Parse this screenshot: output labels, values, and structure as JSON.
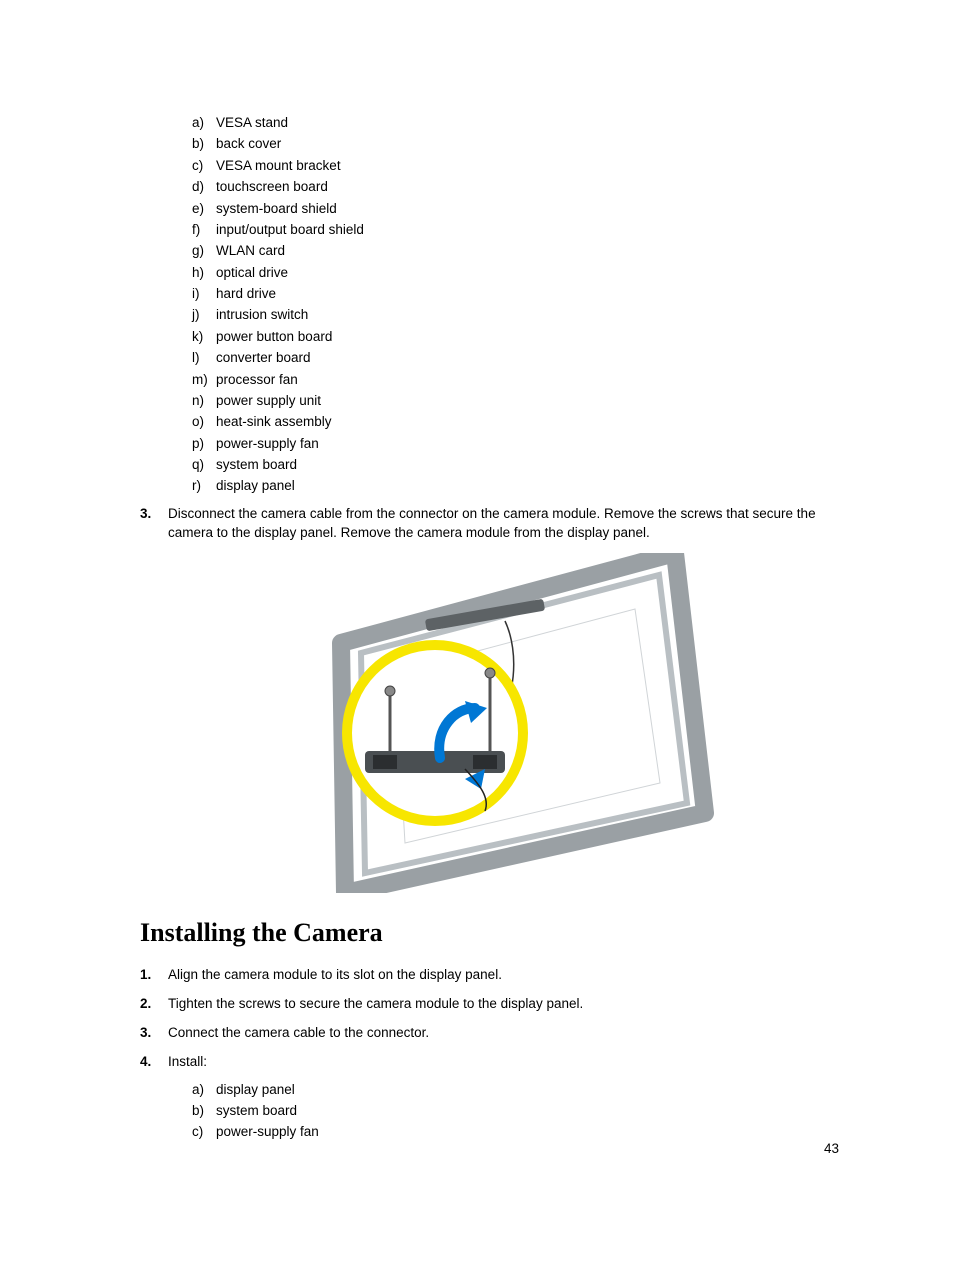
{
  "removeAlphaList": [
    {
      "marker": "a)",
      "text": "VESA stand"
    },
    {
      "marker": "b)",
      "text": "back cover"
    },
    {
      "marker": "c)",
      "text": "VESA mount bracket"
    },
    {
      "marker": "d)",
      "text": "touchscreen board"
    },
    {
      "marker": "e)",
      "text": "system-board shield"
    },
    {
      "marker": "f)",
      "text": "input/output board shield"
    },
    {
      "marker": "g)",
      "text": "WLAN card"
    },
    {
      "marker": "h)",
      "text": "optical drive"
    },
    {
      "marker": "i)",
      "text": "hard drive"
    },
    {
      "marker": "j)",
      "text": "intrusion switch"
    },
    {
      "marker": "k)",
      "text": "power button board"
    },
    {
      "marker": "l)",
      "text": "converter board"
    },
    {
      "marker": "m)",
      "text": "processor fan"
    },
    {
      "marker": "n)",
      "text": "power supply unit"
    },
    {
      "marker": "o)",
      "text": "heat-sink assembly"
    },
    {
      "marker": "p)",
      "text": "power-supply fan"
    },
    {
      "marker": "q)",
      "text": "system board"
    },
    {
      "marker": "r)",
      "text": "display panel"
    }
  ],
  "step3": {
    "marker": "3.",
    "text": "Disconnect the camera cable from the connector on the camera module. Remove the screws that secure the camera to the display panel. Remove the camera module from the display panel."
  },
  "heading": "Installing the Camera",
  "installSteps": [
    {
      "marker": "1.",
      "text": "Align the camera module to its slot on the display panel."
    },
    {
      "marker": "2.",
      "text": "Tighten the screws to secure the camera module to the display panel."
    },
    {
      "marker": "3.",
      "text": "Connect the camera cable to the connector."
    },
    {
      "marker": "4.",
      "text": "Install:"
    }
  ],
  "installAlphaList": [
    {
      "marker": "a)",
      "text": "display panel"
    },
    {
      "marker": "b)",
      "text": "system board"
    },
    {
      "marker": "c)",
      "text": "power-supply fan"
    }
  ],
  "pageNumber": "43"
}
